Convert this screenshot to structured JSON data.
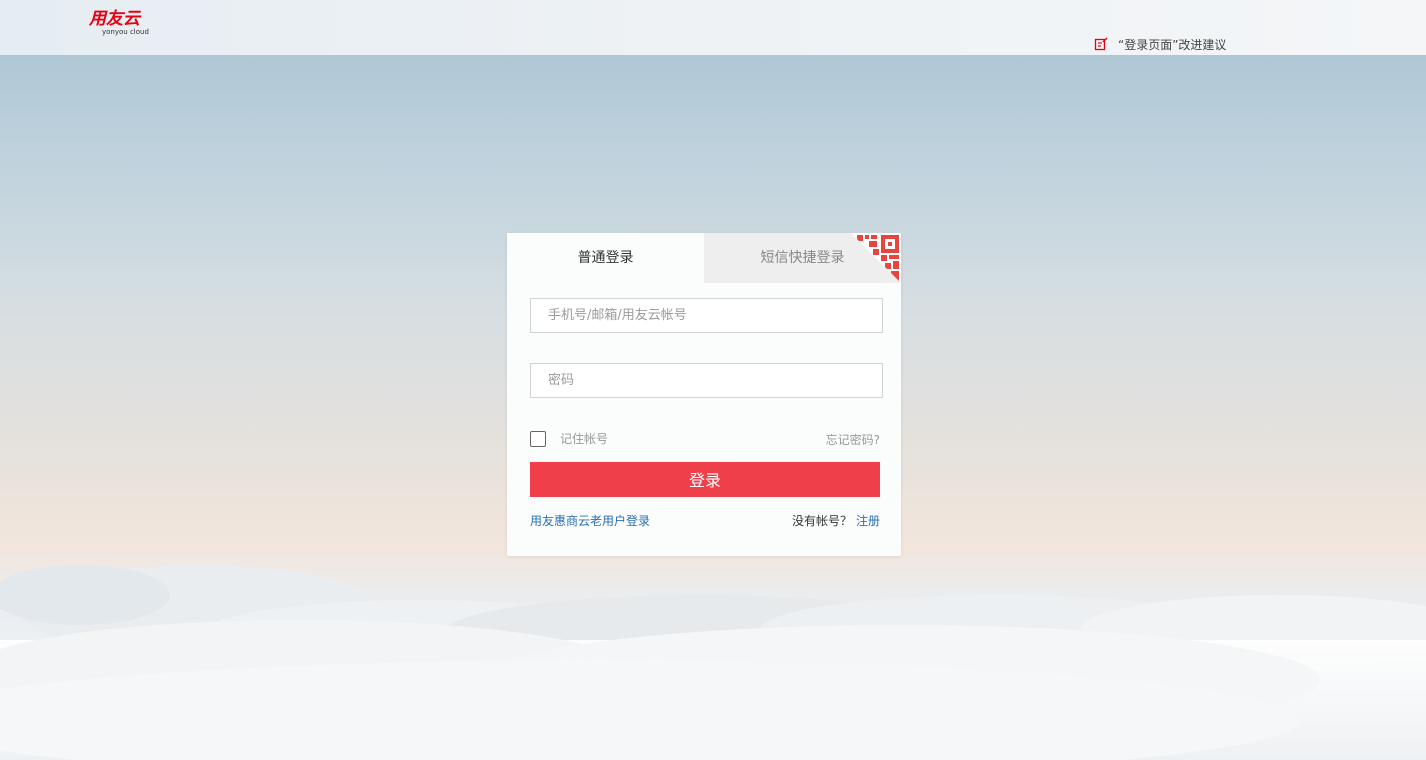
{
  "header": {
    "logo_text": "用友云",
    "logo_subtext": "yonyou cloud",
    "feedback_label": "“登录页面”改进建议"
  },
  "login": {
    "tabs": [
      {
        "label": "普通登录",
        "active": true
      },
      {
        "label": "短信快捷登录",
        "active": false
      }
    ],
    "account_placeholder": "手机号/邮箱/用友云帐号",
    "password_placeholder": "密码",
    "remember_label": "记住帐号",
    "remember_checked": false,
    "forgot_label": "忘记密码?",
    "submit_label": "登录",
    "old_user_label": "用友惠商云老用户登录",
    "no_account_label": "没有帐号？",
    "register_label": "注册"
  },
  "colors": {
    "brand_red": "#e60012",
    "button_red": "#ee3f4a",
    "link_blue": "#2a6fb5",
    "qr_red": "#e8453c"
  }
}
